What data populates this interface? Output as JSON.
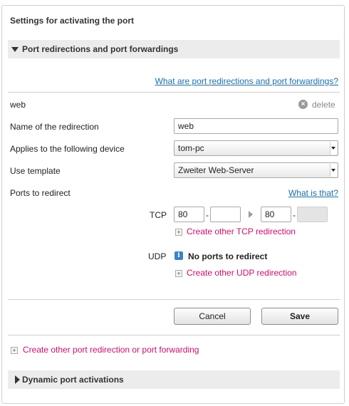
{
  "panel": {
    "title": "Settings for activating the port"
  },
  "section1": {
    "title": "Port redirections and port forwardings"
  },
  "help_link": "What are port redirections and port forwardings?",
  "entry": {
    "name": "web",
    "delete_label": "delete"
  },
  "fields": {
    "name_label": "Name of the redirection",
    "name_value": "web",
    "device_label": "Applies to the following device",
    "device_value": "tom-pc",
    "template_label": "Use template",
    "template_value": "Zweiter Web-Server",
    "ports_label": "Ports to redirect",
    "ports_help": "What is that?"
  },
  "tcp": {
    "label": "TCP",
    "from_start": "80",
    "from_end": "",
    "to_start": "80",
    "to_end": "",
    "dash": "-",
    "create_link": "Create other TCP redirection"
  },
  "udp": {
    "label": "UDP",
    "info_icon_glyph": "i",
    "no_ports": "No ports to redirect",
    "create_link": "Create other UDP redirection"
  },
  "buttons": {
    "cancel": "Cancel",
    "save": "Save"
  },
  "create_other": "Create other port redirection or port forwarding",
  "section2": {
    "title": "Dynamic port activations"
  },
  "colors": {
    "link_blue": "#1d6fa7",
    "link_pink": "#c8106c",
    "section_bg": "#ececec"
  }
}
